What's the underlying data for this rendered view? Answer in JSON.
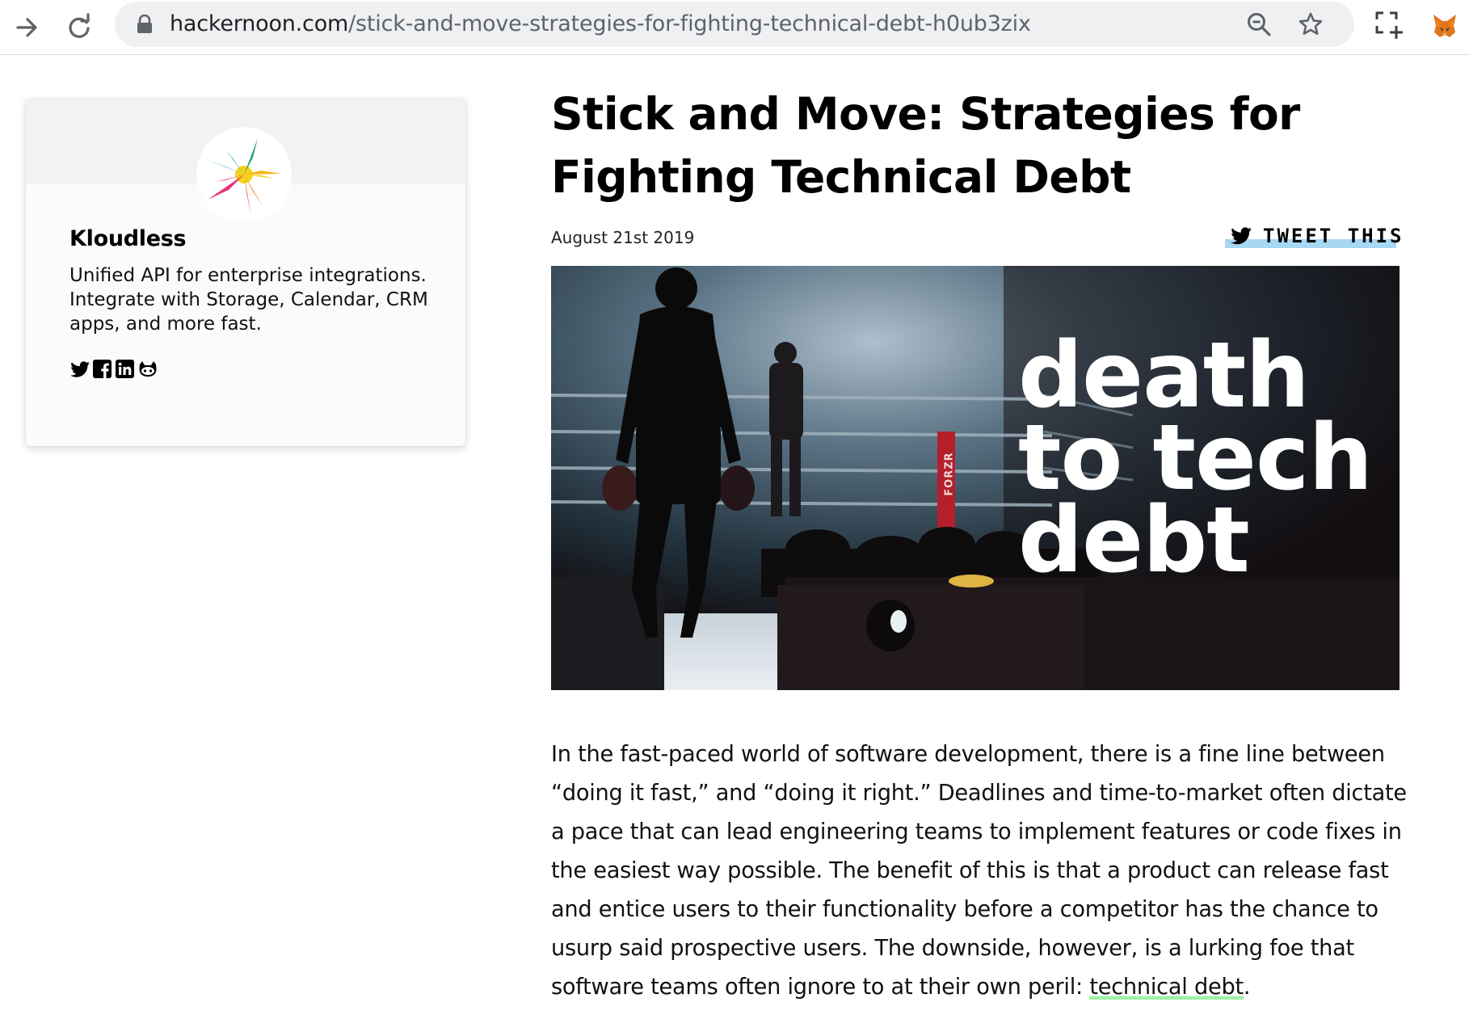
{
  "browser": {
    "url_host": "hackernoon.com",
    "url_path": "/stick-and-move-strategies-for-fighting-technical-debt-h0ub3zix",
    "icons": [
      "forward-icon",
      "reload-icon",
      "lock-icon",
      "zoom-icon",
      "bookmark-star-icon",
      "extension-screenshot-icon",
      "metamask-fox-icon"
    ]
  },
  "author": {
    "name": "Kloudless",
    "bio": "Unified API for enterprise integrations. Integrate with Storage, Calendar, CRM apps, and more fast.",
    "socials": [
      "twitter-icon",
      "facebook-icon",
      "linkedin-icon",
      "github-icon"
    ]
  },
  "article": {
    "title": "Stick and Move: Strategies for Fighting Technical Debt",
    "date": "August 21st 2019",
    "tweet_label": "TWEET THIS",
    "hero": {
      "line1": "death",
      "line2": "to tech",
      "line3": "debt",
      "ring_banner": "FORZR"
    },
    "body_before_link": "In the fast-paced world of software development, there is a fine line between “doing it fast,” and “doing it right.” Deadlines and time-to-market often dictate a pace that can lead engineering teams to implement features or code fixes in the easiest way possible. The benefit of this is that a product can release fast and entice users to their functionality before a competitor has the chance to usurp said prospective users. The downside, however, is a lurking foe that software teams often ignore to at their own peril: ",
    "body_link": "technical debt",
    "body_after_link": "."
  },
  "colors": {
    "omnibox_bg": "#eef0f2",
    "tweet_highlight": "#a6d7f3",
    "link_underline": "#9ff0a8"
  }
}
